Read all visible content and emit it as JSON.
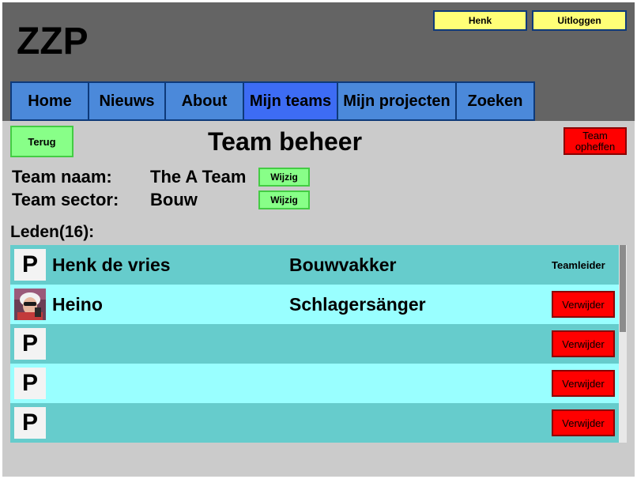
{
  "header": {
    "logo": "ZZP",
    "user_button": "Henk",
    "logout_button": "Uitloggen"
  },
  "nav": {
    "items": [
      "Home",
      "Nieuws",
      "About",
      "Mijn teams",
      "Mijn projecten",
      "Zoeken"
    ],
    "active": "Mijn teams"
  },
  "page": {
    "back_button": "Terug",
    "title": "Team beheer",
    "dissolve_button": "Team opheffen",
    "team_name_label": "Team naam:",
    "team_name_value": "The A Team",
    "team_sector_label": "Team sector:",
    "team_sector_value": "Bouw",
    "edit_button": "Wijzig",
    "members_label": "Leden(16):"
  },
  "members": [
    {
      "avatar": "P",
      "name": "Henk de vries",
      "role": "Bouwvakker",
      "action": "Teamleider"
    },
    {
      "avatar": "photo",
      "name": "Heino",
      "role": "Schlagersänger",
      "action": "Verwijder"
    },
    {
      "avatar": "P",
      "name": "",
      "role": "",
      "action": "Verwijder"
    },
    {
      "avatar": "P",
      "name": "",
      "role": "",
      "action": "Verwijder"
    },
    {
      "avatar": "P",
      "name": "",
      "role": "",
      "action": "Verwijder"
    }
  ],
  "colors": {
    "header_bg": "#646464",
    "nav_bg": "#4b89da",
    "nav_active_bg": "#3d6cf4",
    "row_dark": "#66cccc",
    "row_light": "#99ffff",
    "delete_red": "#ff0000",
    "edit_green": "#88ff88",
    "top_button_yellow": "#ffff77"
  }
}
